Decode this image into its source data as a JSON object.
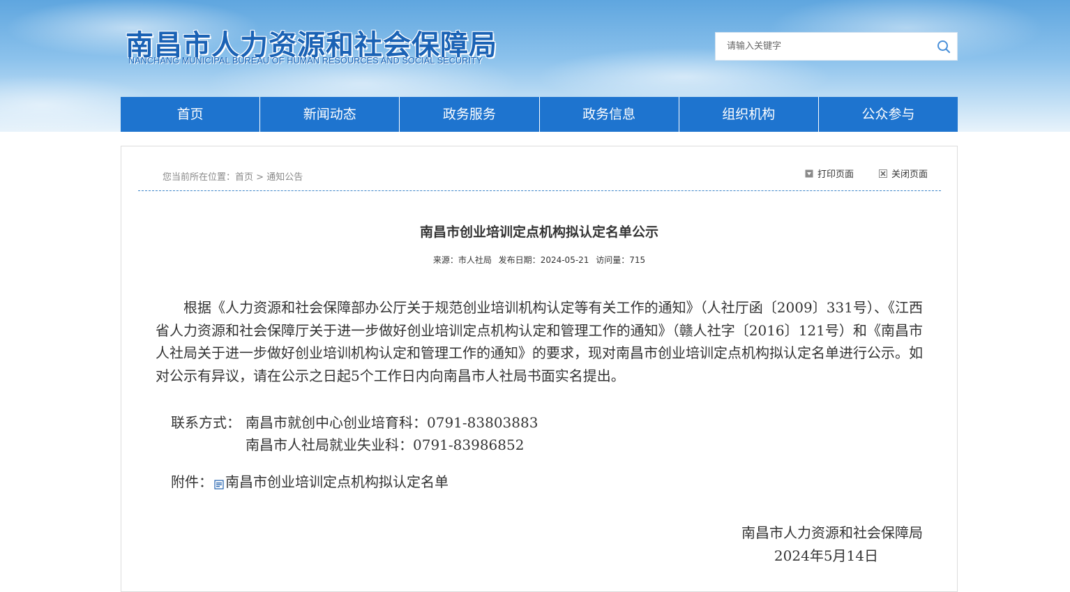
{
  "header": {
    "logo_cn": "南昌市人力资源和社会保障局",
    "logo_en": "NANCHANG MUNICIPAL BUREAU OF HUMAN RESOURCES AND SOCIAL SECURITY",
    "search": {
      "placeholder": "请输入关键字",
      "value": "",
      "icon": "search-icon"
    },
    "accent_color": "#1e74cf"
  },
  "nav": {
    "items": [
      {
        "label": "首页"
      },
      {
        "label": "新闻动态"
      },
      {
        "label": "政务服务"
      },
      {
        "label": "政务信息"
      },
      {
        "label": "组织机构"
      },
      {
        "label": "公众参与"
      }
    ]
  },
  "breadcrumb": {
    "prefix": "您当前所在位置：",
    "home": "首页",
    "sep": ">",
    "current": "通知公告"
  },
  "tools": {
    "print": {
      "label": "打印页面",
      "icon": "print-icon"
    },
    "close": {
      "label": "关闭页面",
      "icon": "close-icon"
    }
  },
  "article": {
    "title": "南昌市创业培训定点机构拟认定名单公示",
    "meta": {
      "source_label": "来源：",
      "source": "市人社局",
      "date_label": "发布日期：",
      "date": "2024-05-21",
      "views_label": "访问量：",
      "views": "715"
    },
    "body": "根据《人力资源和社会保障部办公厅关于规范创业培训机构认定等有关工作的通知》（人社厅函〔2009〕331号）、《江西省人力资源和社会保障厅关于进一步做好创业培训定点机构认定和管理工作的通知》（赣人社字〔2016〕121号）和《南昌市人社局关于进一步做好创业培训机构认定和管理工作的通知》的要求，现对南昌市创业培训定点机构拟认定名单进行公示。如对公示有异议，请在公示之日起5个工作日内向南昌市人社局书面实名提出。",
    "contact_label": "联系方式：",
    "contacts": [
      "南昌市就创中心创业培育科：0791-83803883",
      "南昌市人社局就业失业科：0791-83986852"
    ],
    "attachment_label": "附件：",
    "attachment": {
      "name": "南昌市创业培训定点机构拟认定名单",
      "icon": "document-icon"
    },
    "signature_org": "南昌市人力资源和社会保障局",
    "signature_date": "2024年5月14日"
  }
}
